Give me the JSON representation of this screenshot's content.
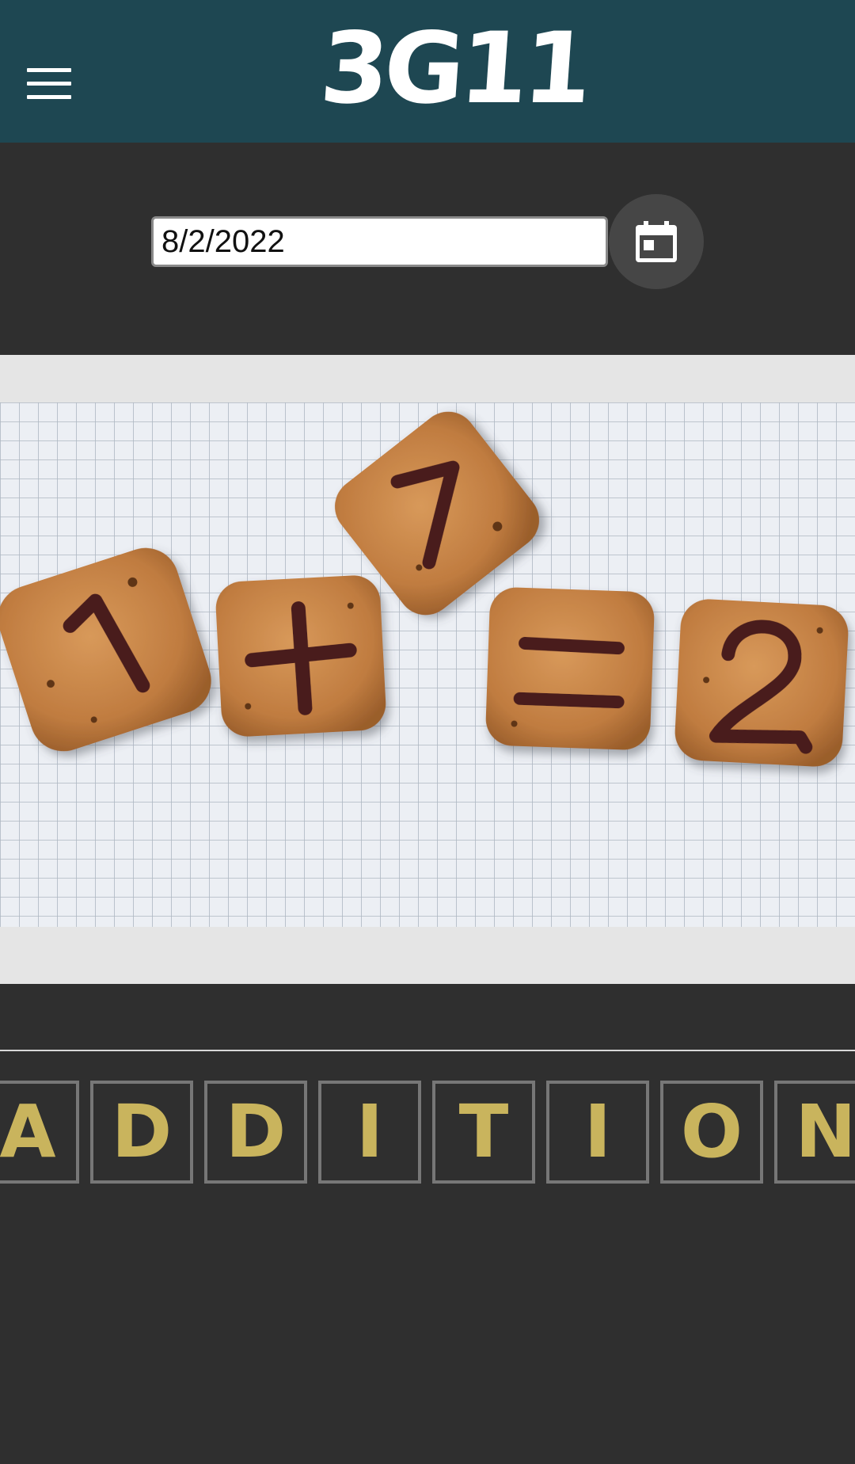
{
  "header": {
    "menu_icon": "hamburger-menu-icon",
    "logo_text": "3G11",
    "background_color": "#1e4752"
  },
  "date_picker": {
    "value": "8/2/2022",
    "calendar_icon": "calendar-icon"
  },
  "puzzle_image": {
    "grid_color": "#aeb7c2",
    "cookies": [
      "1",
      "+",
      "1",
      "=",
      "2"
    ]
  },
  "word": {
    "letters": [
      "A",
      "D",
      "D",
      "I",
      "T",
      "I",
      "O",
      "N"
    ],
    "letter_color": "#c9b45d",
    "tile_border_color": "#777777"
  }
}
